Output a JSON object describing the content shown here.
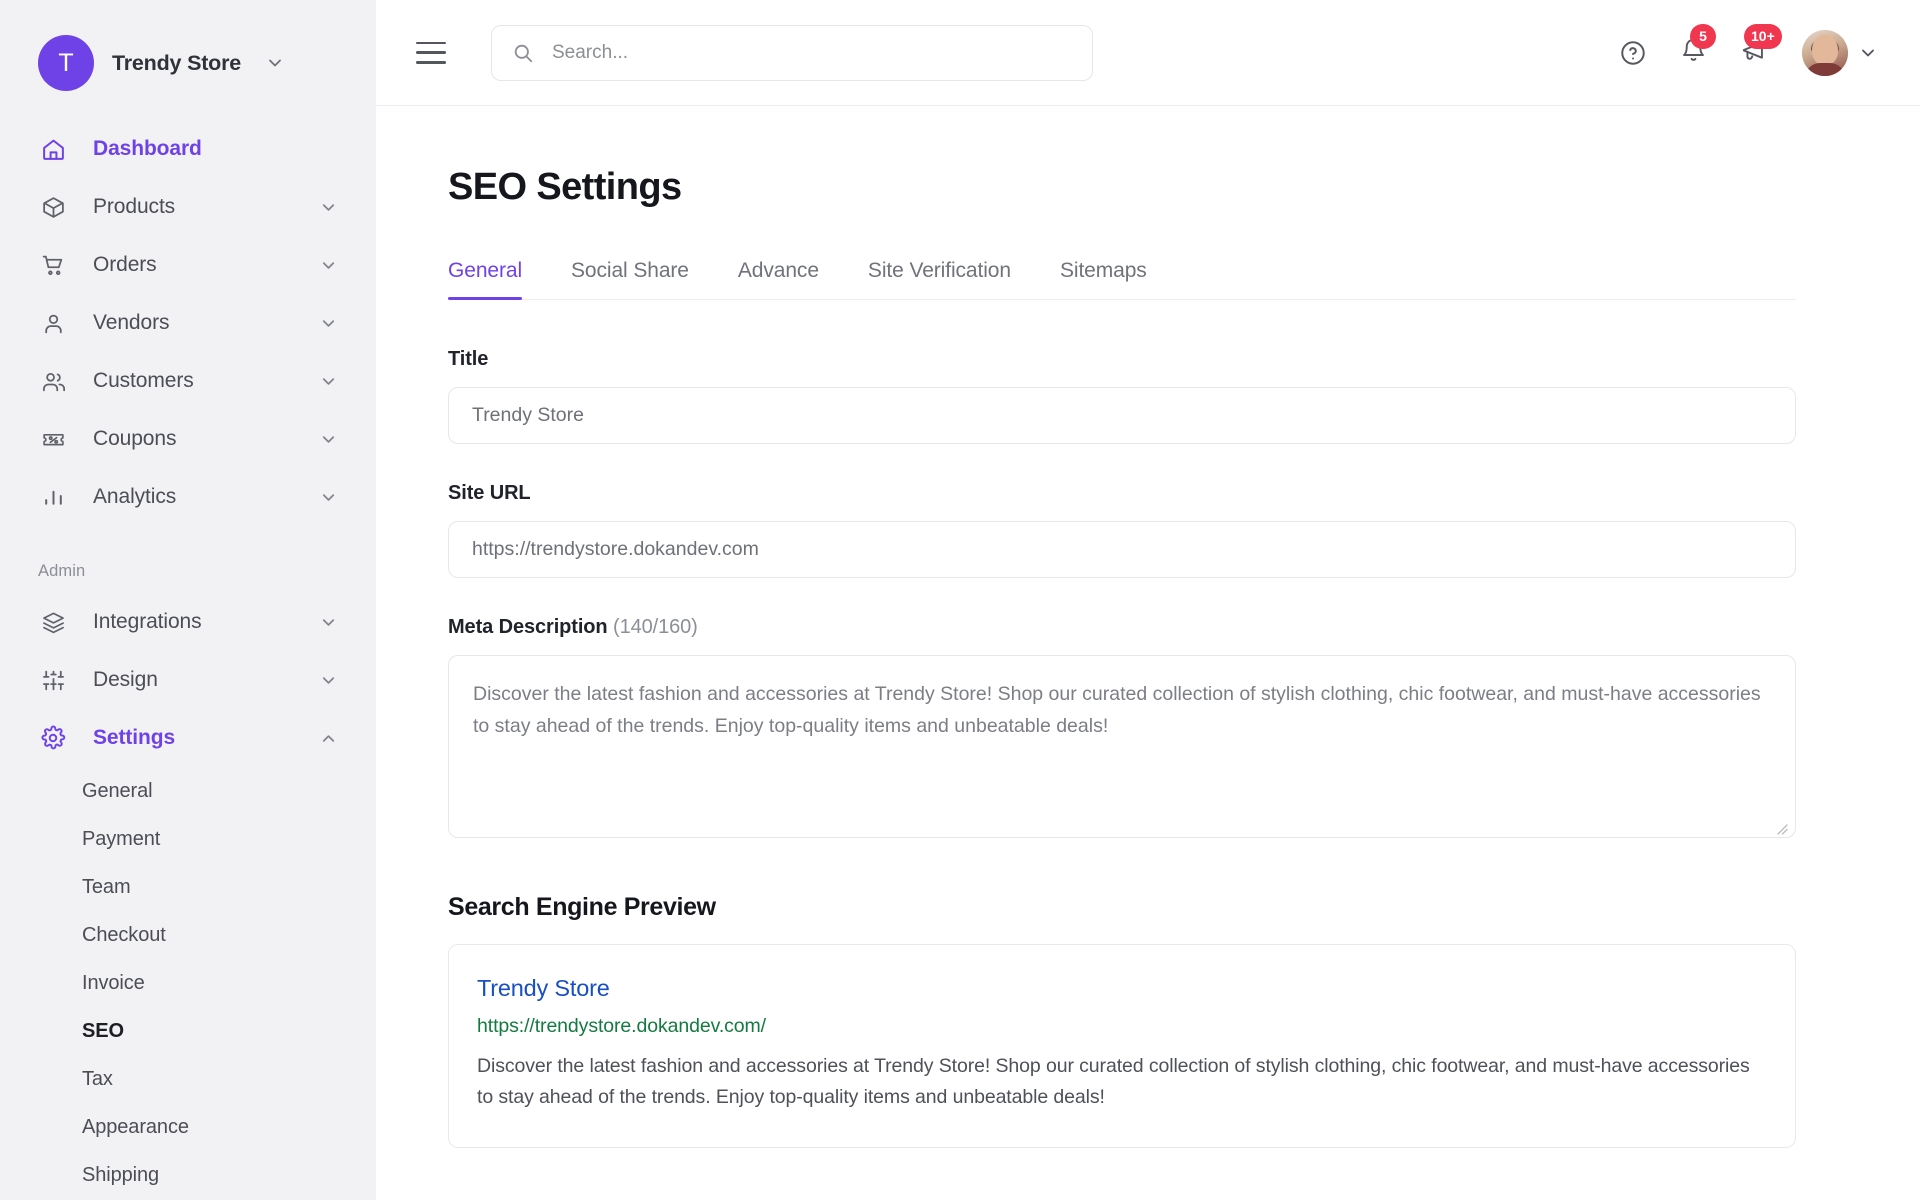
{
  "sidebar": {
    "brand": {
      "initial": "T",
      "name": "Trendy Store",
      "caret_icon": "chevron-down-icon"
    },
    "items": [
      {
        "label": "Dashboard",
        "icon": "home-icon",
        "active": true,
        "chevron": false
      },
      {
        "label": "Products",
        "icon": "box-icon",
        "active": false,
        "chevron": true
      },
      {
        "label": "Orders",
        "icon": "cart-icon",
        "active": false,
        "chevron": true
      },
      {
        "label": "Vendors",
        "icon": "user-icon",
        "active": false,
        "chevron": true
      },
      {
        "label": "Customers",
        "icon": "users-icon",
        "active": false,
        "chevron": true
      },
      {
        "label": "Coupons",
        "icon": "coupon-icon",
        "active": false,
        "chevron": true
      },
      {
        "label": "Analytics",
        "icon": "bar-chart-icon",
        "active": false,
        "chevron": true
      }
    ],
    "section_title": "Admin",
    "admin_items": [
      {
        "label": "Integrations",
        "icon": "layers-icon",
        "active": false,
        "chevron": "down"
      },
      {
        "label": "Design",
        "icon": "sliders-icon",
        "active": false,
        "chevron": "down"
      },
      {
        "label": "Settings",
        "icon": "gear-icon",
        "active": true,
        "chevron": "up"
      }
    ],
    "settings_submenu": [
      {
        "label": "General",
        "active": false
      },
      {
        "label": "Payment",
        "active": false
      },
      {
        "label": "Team",
        "active": false
      },
      {
        "label": "Checkout",
        "active": false
      },
      {
        "label": "Invoice",
        "active": false
      },
      {
        "label": "SEO",
        "active": true
      },
      {
        "label": "Tax",
        "active": false
      },
      {
        "label": "Appearance",
        "active": false
      },
      {
        "label": "Shipping",
        "active": false
      }
    ]
  },
  "topbar": {
    "menu_icon": "hamburger-icon",
    "search": {
      "placeholder": "Search...",
      "value": "",
      "icon": "search-icon"
    },
    "help_icon": "help-circle-icon",
    "notifications": {
      "icon": "bell-icon",
      "badge": "5"
    },
    "announcements": {
      "icon": "megaphone-icon",
      "badge": "10+"
    },
    "profile": {
      "avatar": "user-avatar",
      "caret_icon": "chevron-down-icon"
    }
  },
  "page": {
    "title": "SEO Settings",
    "tabs": [
      {
        "label": "General",
        "active": true
      },
      {
        "label": "Social Share",
        "active": false
      },
      {
        "label": "Advance",
        "active": false
      },
      {
        "label": "Site Verification",
        "active": false
      },
      {
        "label": "Sitemaps",
        "active": false
      }
    ],
    "fields": {
      "title": {
        "label": "Title",
        "value": "Trendy Store"
      },
      "site_url": {
        "label": "Site URL",
        "value": "https://trendystore.dokandev.com"
      },
      "meta_description": {
        "label": "Meta Description",
        "counter": "(140/160)",
        "value": "Discover the latest fashion and accessories at Trendy Store! Shop our curated collection of stylish clothing, chic footwear, and must-have accessories to stay ahead of the trends. Enjoy top-quality items and unbeatable deals!"
      }
    },
    "preview": {
      "heading": "Search Engine Preview",
      "title": "Trendy Store",
      "url": "https://trendystore.dokandev.com/",
      "description": "Discover the latest fashion and accessories at Trendy Store! Shop our curated collection of stylish clothing, chic footwear, and must-have accessories to stay ahead of the trends. Enjoy top-quality items and unbeatable deals!"
    }
  },
  "colors": {
    "accent": "#6f42e8",
    "badge": "#f0374f",
    "link": "#1a4fc4",
    "url_green": "#157a41",
    "sidebar_bg": "#f2f2f5"
  }
}
